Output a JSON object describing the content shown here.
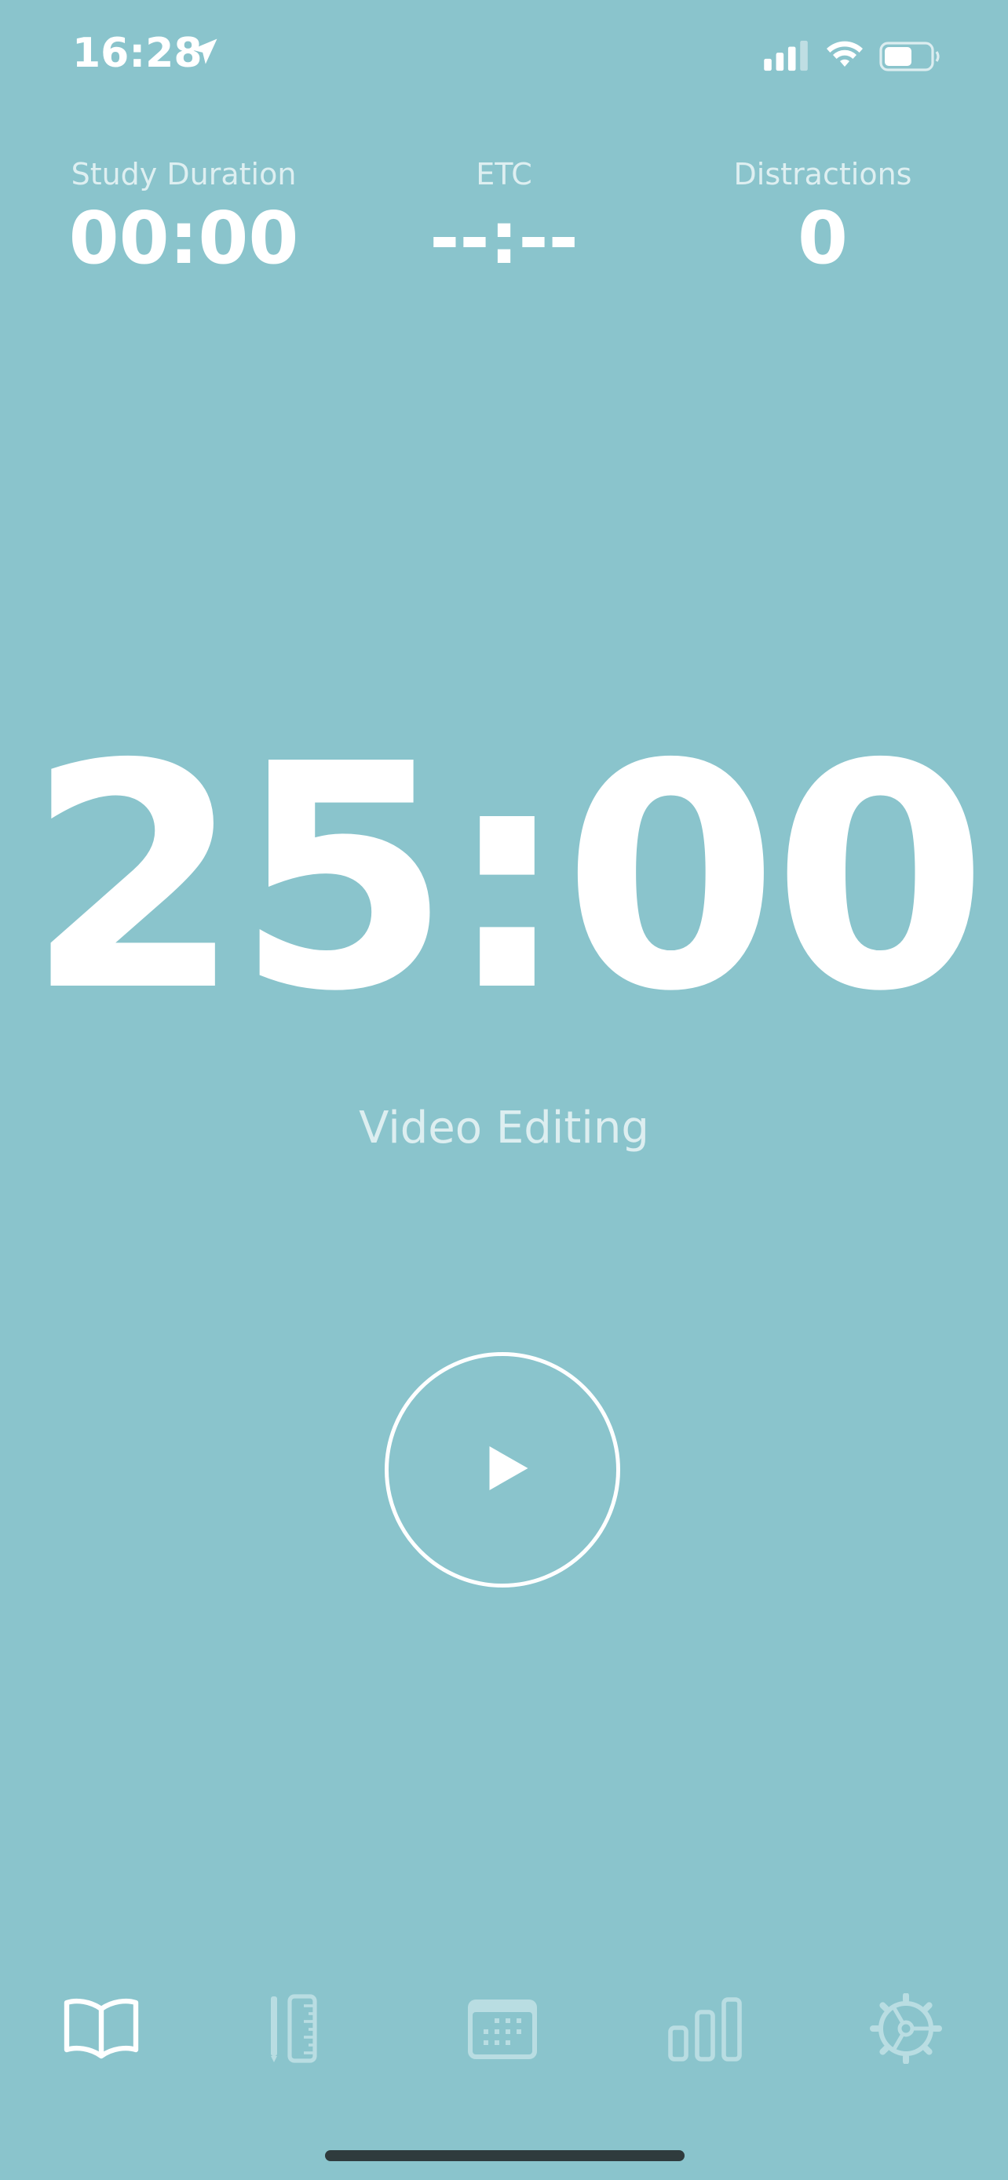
{
  "status_bar": {
    "time": "16:28",
    "icons": [
      "location-arrow-icon",
      "cellular-signal-icon",
      "wifi-icon",
      "battery-icon"
    ]
  },
  "stats": {
    "study_duration": {
      "label": "Study Duration",
      "value": "00:00"
    },
    "etc": {
      "label": "ETC",
      "value": "--:--"
    },
    "distractions": {
      "label": "Distractions",
      "value": "0"
    }
  },
  "timer": {
    "value": "25:00",
    "task": "Video Editing"
  },
  "controls": {
    "play_icon": "play-icon"
  },
  "tab_bar": {
    "tabs": [
      {
        "icon": "open-book-icon"
      },
      {
        "icon": "pencil-ruler-icon"
      },
      {
        "icon": "calendar-icon"
      },
      {
        "icon": "bar-chart-icon"
      },
      {
        "icon": "gear-icon"
      }
    ]
  },
  "colors": {
    "background": "#8AC4CC",
    "foreground": "#FFFFFF",
    "inactive_icon": "#B9DDE2"
  }
}
